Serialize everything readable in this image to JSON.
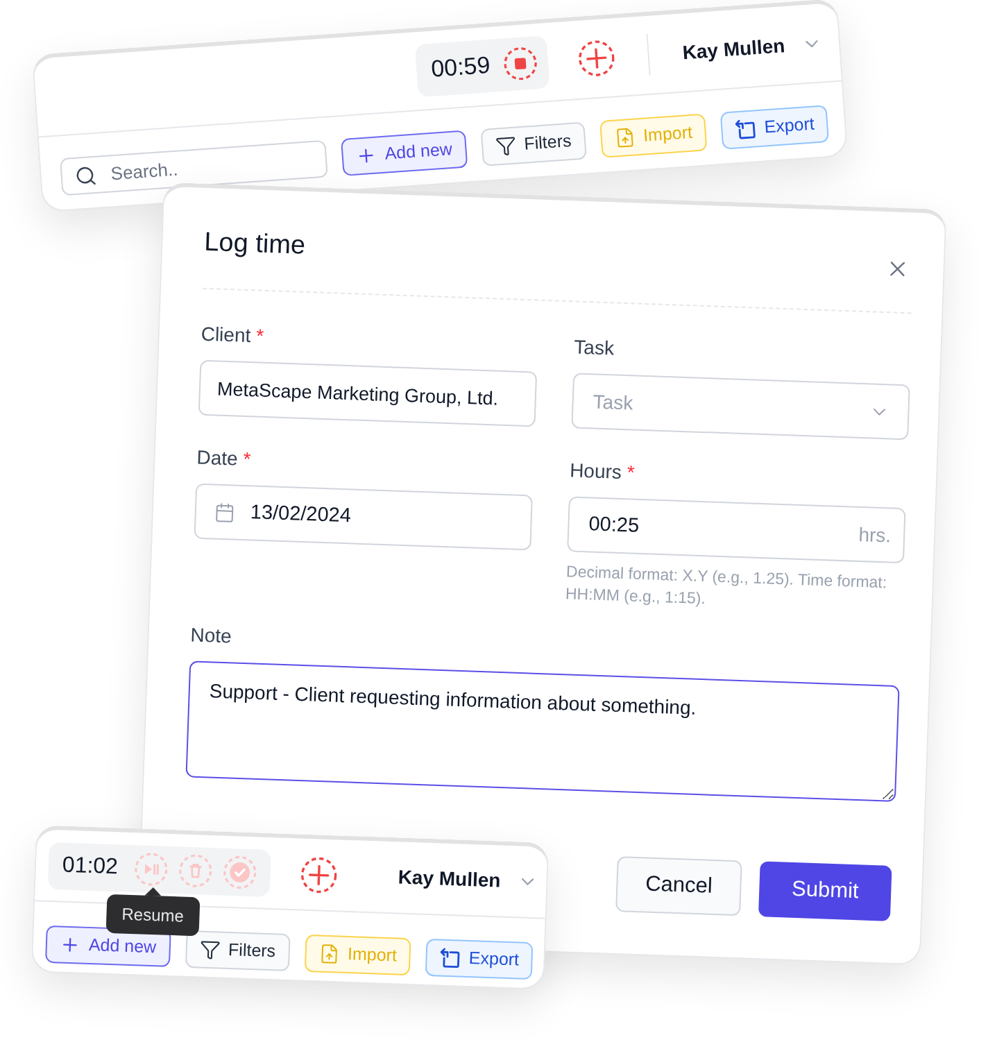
{
  "top_toolbar": {
    "timer": {
      "time": "00:59",
      "actions": [
        {
          "kind": "stop",
          "disabled": false
        }
      ]
    },
    "user_name": "Kay Mullen",
    "search": {
      "placeholder": "Search.."
    },
    "actions": [
      {
        "kind": "add",
        "label": "Add new"
      },
      {
        "kind": "filter",
        "label": "Filters"
      },
      {
        "kind": "import",
        "label": "Import"
      },
      {
        "kind": "export",
        "label": "Export"
      }
    ]
  },
  "dialog": {
    "title": "Log time",
    "fields": [
      {
        "kind": "text",
        "label": "Client",
        "required_mark": "*",
        "value": "MetaScape Marketing Group, Ltd.",
        "focused": false
      },
      {
        "kind": "select",
        "label": "Task",
        "placeholder": "Task",
        "focused": false
      },
      {
        "kind": "date",
        "label": "Date",
        "required_mark": "*",
        "value": "13/02/2024",
        "focused": false
      },
      {
        "kind": "duration",
        "label": "Hours",
        "required_mark": "*",
        "value": "00:25",
        "unit": "hrs.",
        "hint": "Decimal format: X.Y (e.g., 1.25). Time format: HH:MM (e.g., 1:15).",
        "focused": false
      },
      {
        "kind": "textarea",
        "label": "Note",
        "value": "Support - Client requesting information about something.",
        "focused": true
      }
    ],
    "buttons": [
      {
        "kind": "secondary",
        "label": "Cancel"
      },
      {
        "kind": "primary",
        "label": "Submit"
      }
    ]
  },
  "bottom_toolbar": {
    "timer": {
      "time": "01:02",
      "actions": [
        {
          "kind": "resume",
          "disabled": true
        },
        {
          "kind": "delete",
          "disabled": true
        },
        {
          "kind": "complete",
          "disabled": true
        }
      ]
    },
    "tooltip": "Resume",
    "user_name": "Kay Mullen",
    "actions": [
      {
        "kind": "add",
        "label": "Add new"
      },
      {
        "kind": "filter",
        "label": "Filters"
      },
      {
        "kind": "import",
        "label": "Import"
      },
      {
        "kind": "export",
        "label": "Export"
      }
    ]
  }
}
